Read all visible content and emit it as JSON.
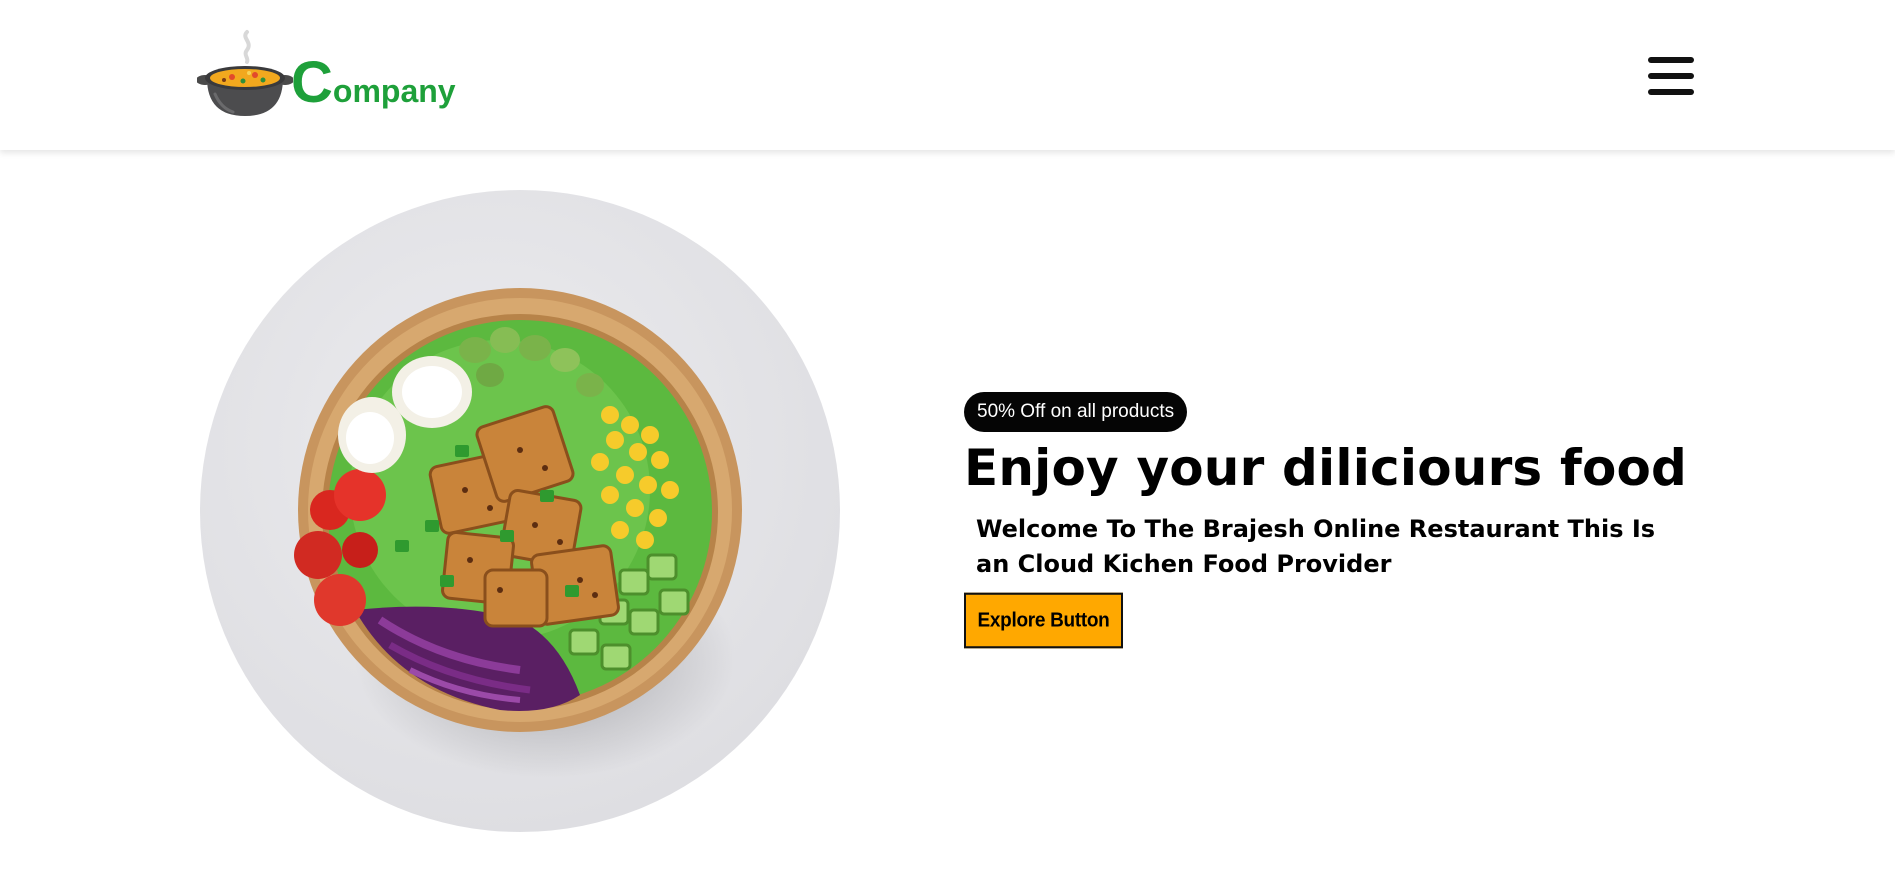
{
  "header": {
    "logo": {
      "initial": "C",
      "rest": "ompany",
      "icon": "soup-pot-icon"
    },
    "menu_icon": "hamburger-menu-icon"
  },
  "hero": {
    "image_icon": "salad-bowl-image",
    "badge": "50% Off on all products",
    "headline": "Enjoy your diliciours food",
    "subheadline": "Welcome To The Brajesh Online Restaurant This Is an Cloud Kichen Food Provider",
    "cta_label": "Explore Button"
  },
  "colors": {
    "brand_green": "#1ea03a",
    "cta_orange": "#ffa800",
    "badge_bg": "#050505",
    "circle_bg": "#e5e5e8"
  }
}
